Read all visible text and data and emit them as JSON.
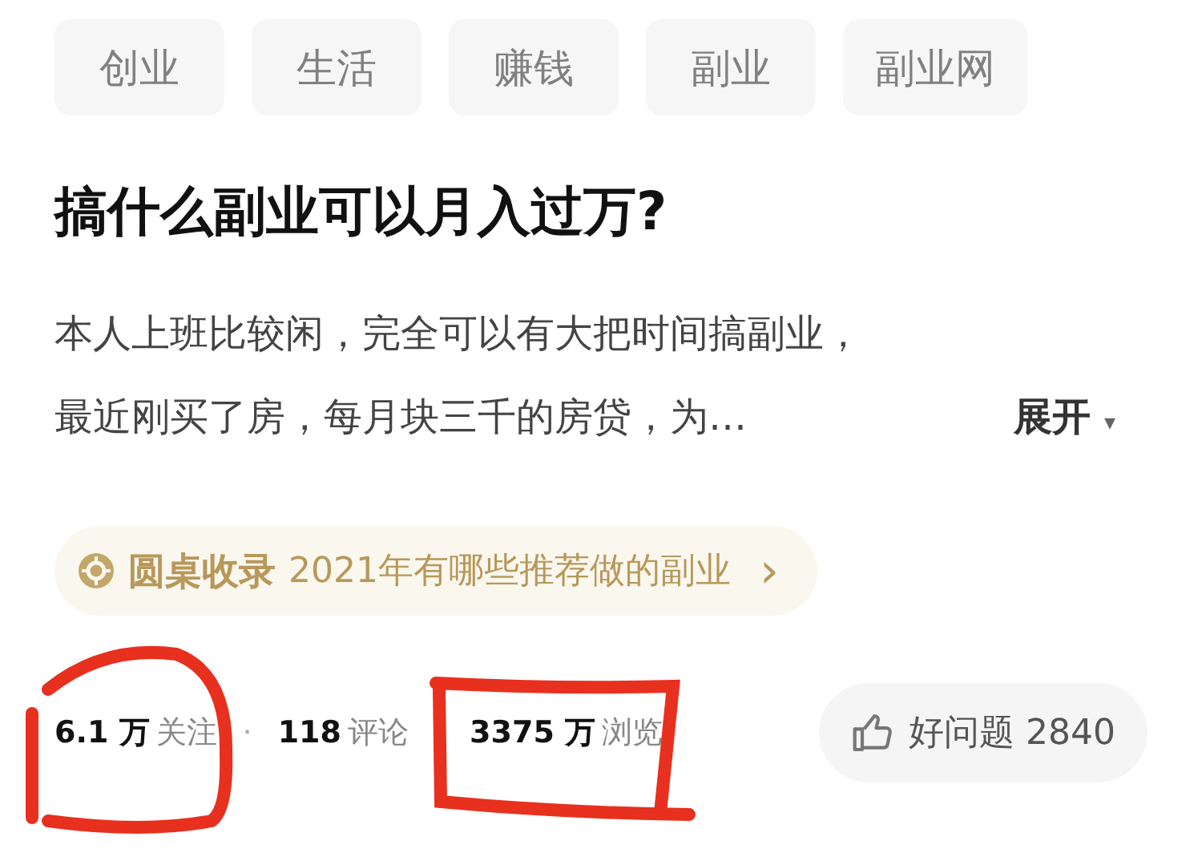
{
  "topics": [
    {
      "label": "创业"
    },
    {
      "label": "生活"
    },
    {
      "label": "赚钱"
    },
    {
      "label": "副业"
    },
    {
      "label": "副业网"
    }
  ],
  "question": {
    "title": "搞什么副业可以月入过万?",
    "excerpt_lines": [
      "本人上班比较闲，完全可以有大把时间搞副业，",
      "最近刚买了房，每月块三千的房贷，为…"
    ],
    "expand": {
      "label": "展开",
      "caret": "▾"
    }
  },
  "collection": {
    "badge": "圆桌收录",
    "text": "2021年有哪些推荐做的副业",
    "chevron": "›"
  },
  "stats": [
    {
      "value": "6.1 万",
      "label": "关注"
    },
    {
      "value": "118",
      "label": "评论"
    },
    {
      "value": "3375 万",
      "label": "浏览"
    }
  ],
  "stats_separator": "·",
  "like_button": {
    "label": "好问题 2840"
  }
}
